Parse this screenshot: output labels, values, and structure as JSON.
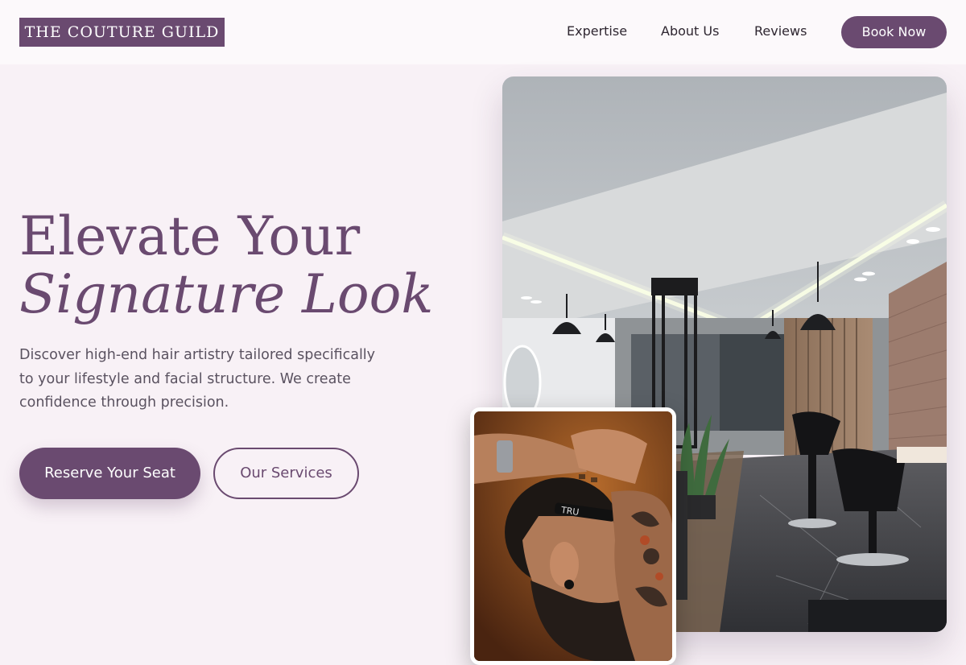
{
  "brand": {
    "name": "THE COUTURE GUILD",
    "accent_color": "#6a4a70"
  },
  "nav": {
    "links": [
      "Expertise",
      "About Us",
      "Reviews"
    ],
    "cta_label": "Book Now"
  },
  "hero": {
    "title_line1": "Elevate Your",
    "title_line2": "Signature Look",
    "description": "Discover high-end hair artistry tailored specifically to your lifestyle and facial structure. We create confidence through precision.",
    "primary_cta": "Reserve Your Seat",
    "secondary_cta": "Our Services"
  },
  "images": {
    "main": "salon-interior-photo",
    "inset": "barber-shaving-photo",
    "razor_text": "TRU"
  }
}
